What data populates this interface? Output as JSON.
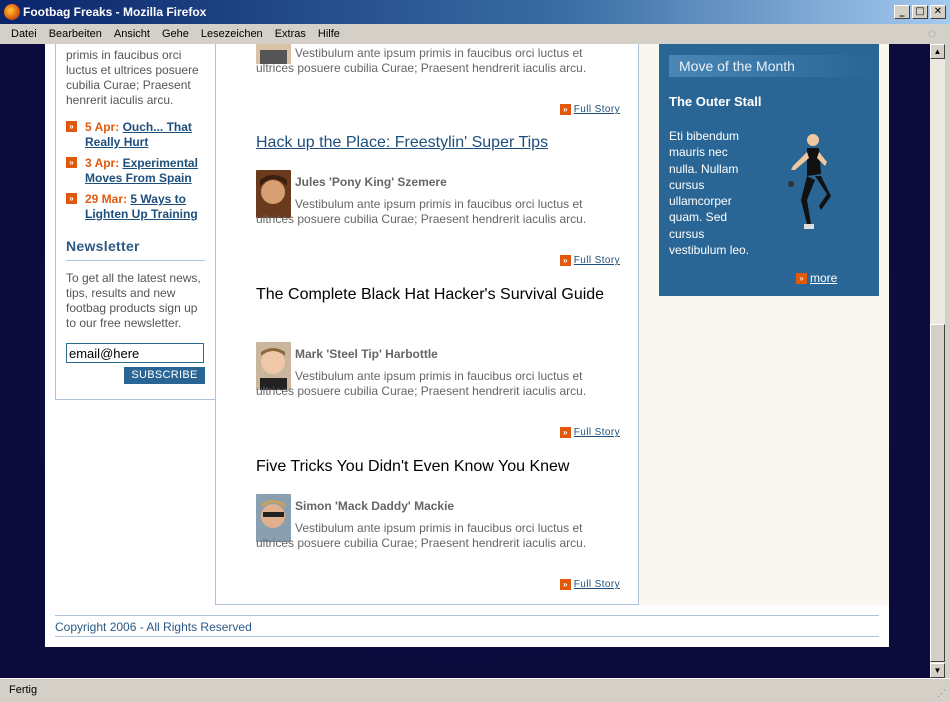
{
  "window": {
    "title": "Footbag Freaks - Mozilla Firefox",
    "buttons": {
      "minimize": "_",
      "maximize": "□",
      "close": "✕"
    }
  },
  "menu": [
    "Datei",
    "Bearbeiten",
    "Ansicht",
    "Gehe",
    "Lesezeichen",
    "Extras",
    "Hilfe"
  ],
  "status": "Fertig",
  "sidebar": {
    "intro_lines": [
      "primis in faucibus orci",
      "luctus et ultrices posuere",
      "cubilia Curae; Praesent",
      "henrerit iaculis arcu."
    ],
    "news": [
      {
        "date": "5 Apr:",
        "title": "Ouch... That Really Hurt"
      },
      {
        "date": "3 Apr:",
        "title": "Experimental Moves From Spain"
      },
      {
        "date": "29 Mar:",
        "title": "5 Ways to Lighten Up Training"
      }
    ],
    "newsletter": {
      "heading": "Newsletter",
      "text": "To get all the latest news, tips, results and new footbag products sign up to our free newsletter.",
      "email_value": "email@here",
      "subscribe_label": "SUBSCRIBE"
    }
  },
  "articles": [
    {
      "title": "",
      "author": "",
      "excerpt": "Vestibulum ante ipsum primis in faucibus orci luctus et ultrices posuere cubilia Curae; Praesent hendrerit iaculis arcu.",
      "full_story": "Full Story"
    },
    {
      "title": "Hack up the Place: Freestylin' Super Tips",
      "author": "Jules 'Pony King' Szemere",
      "excerpt": "Vestibulum ante ipsum primis in faucibus orci luctus et ultrices posuere cubilia Curae; Praesent hendrerit iaculis arcu.",
      "full_story": "Full Story"
    },
    {
      "title": "The Complete Black Hat Hacker's Survival Guide",
      "author": "Mark 'Steel Tip' Harbottle",
      "excerpt": "Vestibulum ante ipsum primis in faucibus orci luctus et ultrices posuere cubilia Curae; Praesent hendrerit iaculis arcu.",
      "full_story": "Full Story"
    },
    {
      "title": "Five Tricks You Didn't Even Know You Knew",
      "author": "Simon 'Mack Daddy' Mackie",
      "excerpt": "Vestibulum ante ipsum primis in faucibus orci luctus et ultrices posuere cubilia Curae; Praesent hendrerit iaculis arcu.",
      "full_story": "Full Story"
    }
  ],
  "move_of_month": {
    "heading": "Move of the Month",
    "title": "The Outer Stall",
    "text": "Eti bibendum mauris nec nulla. Nullam cursus ullamcorper quam. Sed cursus vestibulum leo.",
    "more": "more"
  },
  "footer": {
    "text": "Copyright 2006 - All Rights Reserved"
  },
  "colors": {
    "accent": "#2a6695",
    "link": "#1d4f7c",
    "date": "#e05a10",
    "page_bg": "#10104a"
  }
}
